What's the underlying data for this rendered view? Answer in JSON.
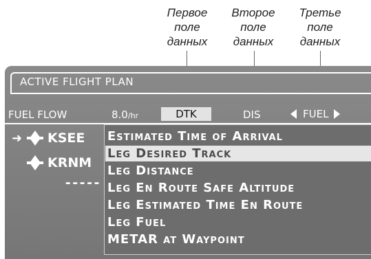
{
  "callouts": [
    {
      "text": "Первое\nполе\nданных"
    },
    {
      "text": "Второе\nполе\nданных"
    },
    {
      "text": "Третье\nполе\nданных"
    }
  ],
  "window": {
    "title": "ACTIVE FLIGHT PLAN"
  },
  "header": {
    "fuel_flow_label": "FUEL FLOW",
    "fuel_flow_value": "8.0",
    "fuel_flow_unit": "/hr",
    "field1": "DTK",
    "field2": "DIS",
    "field3": "FUEL"
  },
  "waypoints": [
    {
      "ident": "KSEE",
      "active": true,
      "icon": "airport-icon"
    },
    {
      "ident": "KRNM",
      "active": false,
      "icon": "airport-icon"
    }
  ],
  "empty_row": "-----",
  "menu": {
    "items": [
      {
        "label": "Estimated Time of Arrival",
        "selected": false
      },
      {
        "label": "Leg Desired Track",
        "selected": true
      },
      {
        "label": "Leg Distance",
        "selected": false
      },
      {
        "label": "Leg En Route Safe Altitude",
        "selected": false
      },
      {
        "label": "Leg Estimated Time En Route",
        "selected": false
      },
      {
        "label": "Leg Fuel",
        "selected": false
      },
      {
        "label": "METAR at Waypoint",
        "selected": false
      }
    ]
  },
  "colors": {
    "screen_bg": "#7b7b7b",
    "menu_bg": "#6d6d6d",
    "highlight": "#e6e6e6",
    "text": "#ffffff"
  }
}
